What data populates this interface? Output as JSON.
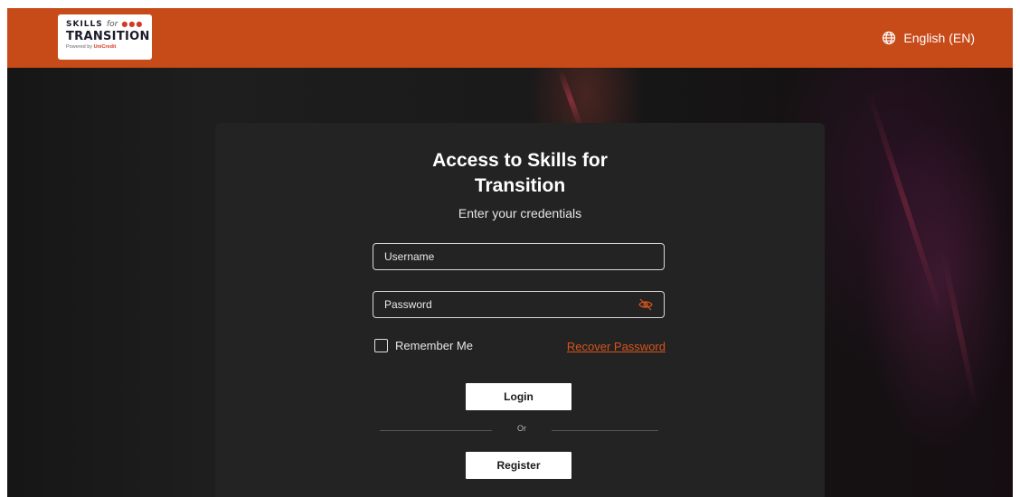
{
  "header": {
    "logo": {
      "line1_word": "SKILLS",
      "line1_for": "for",
      "line1_dots": "●●●",
      "line2": "TRANSITION",
      "line3_prefix": "Powered by",
      "line3_brand": "UniCredit"
    },
    "language_label": "English (EN)",
    "language_icon": "globe-icon",
    "brand_color": "#c74a19"
  },
  "login": {
    "title": "Access to Skills for Transition",
    "subtitle": "Enter your credentials",
    "username_placeholder": "Username",
    "password_placeholder": "Password",
    "password_toggle_icon": "eye-off-icon",
    "remember_label": "Remember Me",
    "recover_label": "Recover Password",
    "login_button": "Login",
    "or_label": "Or",
    "register_button": "Register",
    "accent_color": "#d5541d"
  }
}
